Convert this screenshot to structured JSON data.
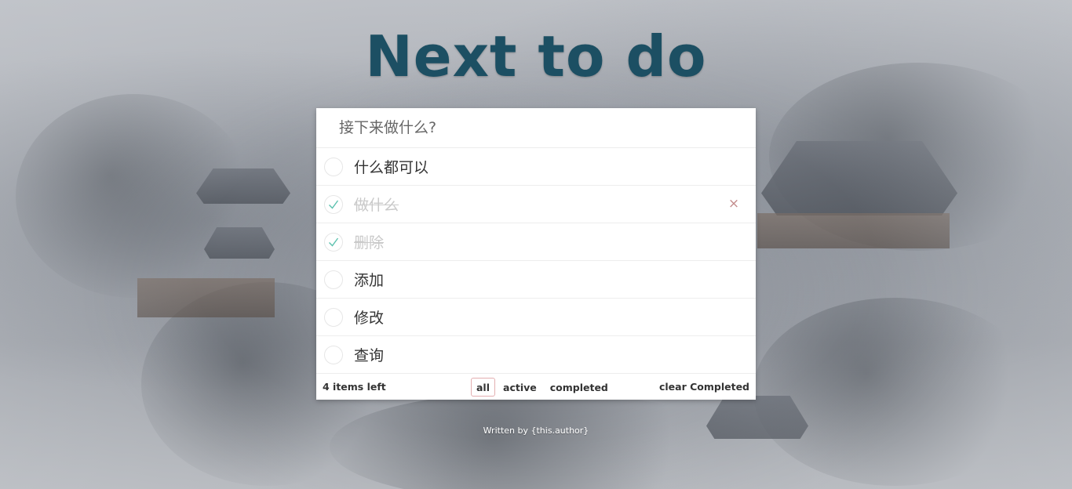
{
  "header": {
    "title": "Next to do"
  },
  "new_todo": {
    "placeholder": "接下来做什么?",
    "value": ""
  },
  "todos": [
    {
      "text": "什么都可以",
      "completed": false
    },
    {
      "text": "做什么",
      "completed": true
    },
    {
      "text": "删除",
      "completed": true
    },
    {
      "text": "添加",
      "completed": false
    },
    {
      "text": "修改",
      "completed": false
    },
    {
      "text": "查询",
      "completed": false
    }
  ],
  "destroy_icon": "×",
  "footer": {
    "items_left": "4 items left",
    "filters": [
      "all",
      "active",
      "completed"
    ],
    "selected_filter": "all",
    "clear_completed": "clear Completed"
  },
  "credit": "Written by {this.author}",
  "colors": {
    "title": "#1c4f63",
    "check": "#5dc2af",
    "destroy": "#c38c8c",
    "selected_filter_border": "#e3aeb0"
  }
}
